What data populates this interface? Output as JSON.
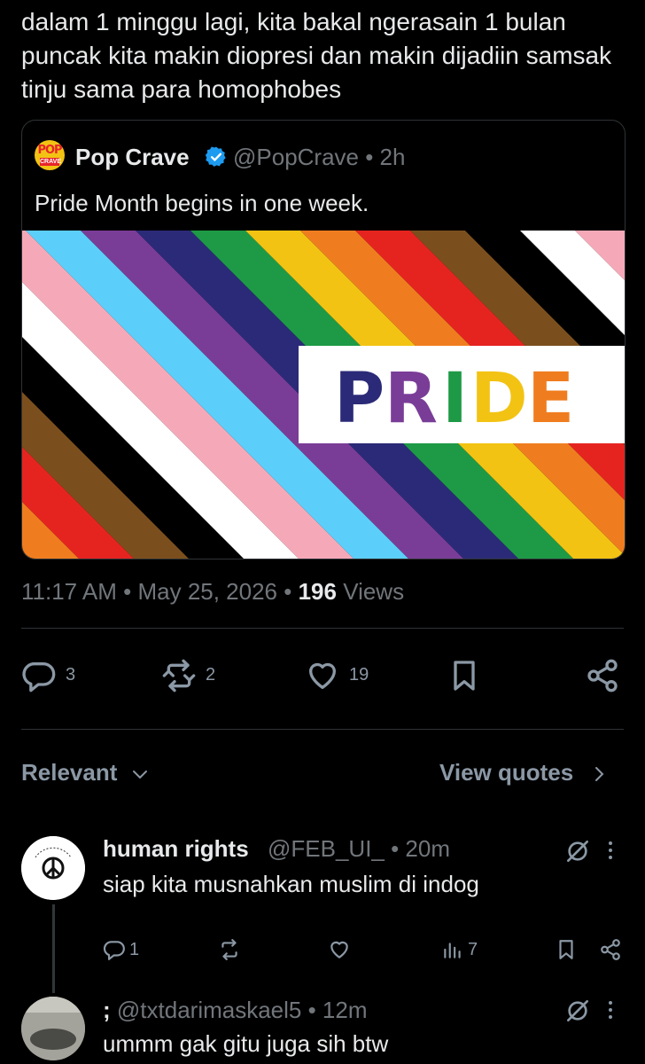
{
  "tweet": {
    "text": "dalam 1 minggu lagi, kita bakal ngerasain 1 bulan puncak kita makin diopresi dan makin dijadiin samsak tinju sama para homophobes"
  },
  "quoted_tweet": {
    "name": "Pop Crave",
    "handle_time": "@PopCrave • 2h",
    "text": "Pride Month begins in one week.",
    "image_word": "PRIDE",
    "avatar_text_top": "POP",
    "avatar_text_bottom": "CRAVE"
  },
  "meta": {
    "time_date": "11:17 AM • May 25, 2026 • ",
    "views_count": "196",
    "views_label": " Views"
  },
  "actions": {
    "reply_count": "3",
    "repost_count": "2",
    "like_count": "19"
  },
  "replies_header": {
    "sort_label": "Relevant",
    "view_quotes": "View quotes"
  },
  "replies": [
    {
      "name": "human rights",
      "handle_time": "@FEB_UI_ • 20m",
      "text": "siap kita musnahkan muslim di indog",
      "reply_count": "1",
      "views_count": "7"
    },
    {
      "name": ";",
      "handle_time": "@txtdarimaskael5 • 12m",
      "text": "ummm gak gitu juga sih btw"
    }
  ],
  "colors": {
    "background": "#000000",
    "text": "#e7e9ea",
    "muted": "#71767b",
    "verified": "#1d9bf0",
    "divider": "#2f3336"
  }
}
